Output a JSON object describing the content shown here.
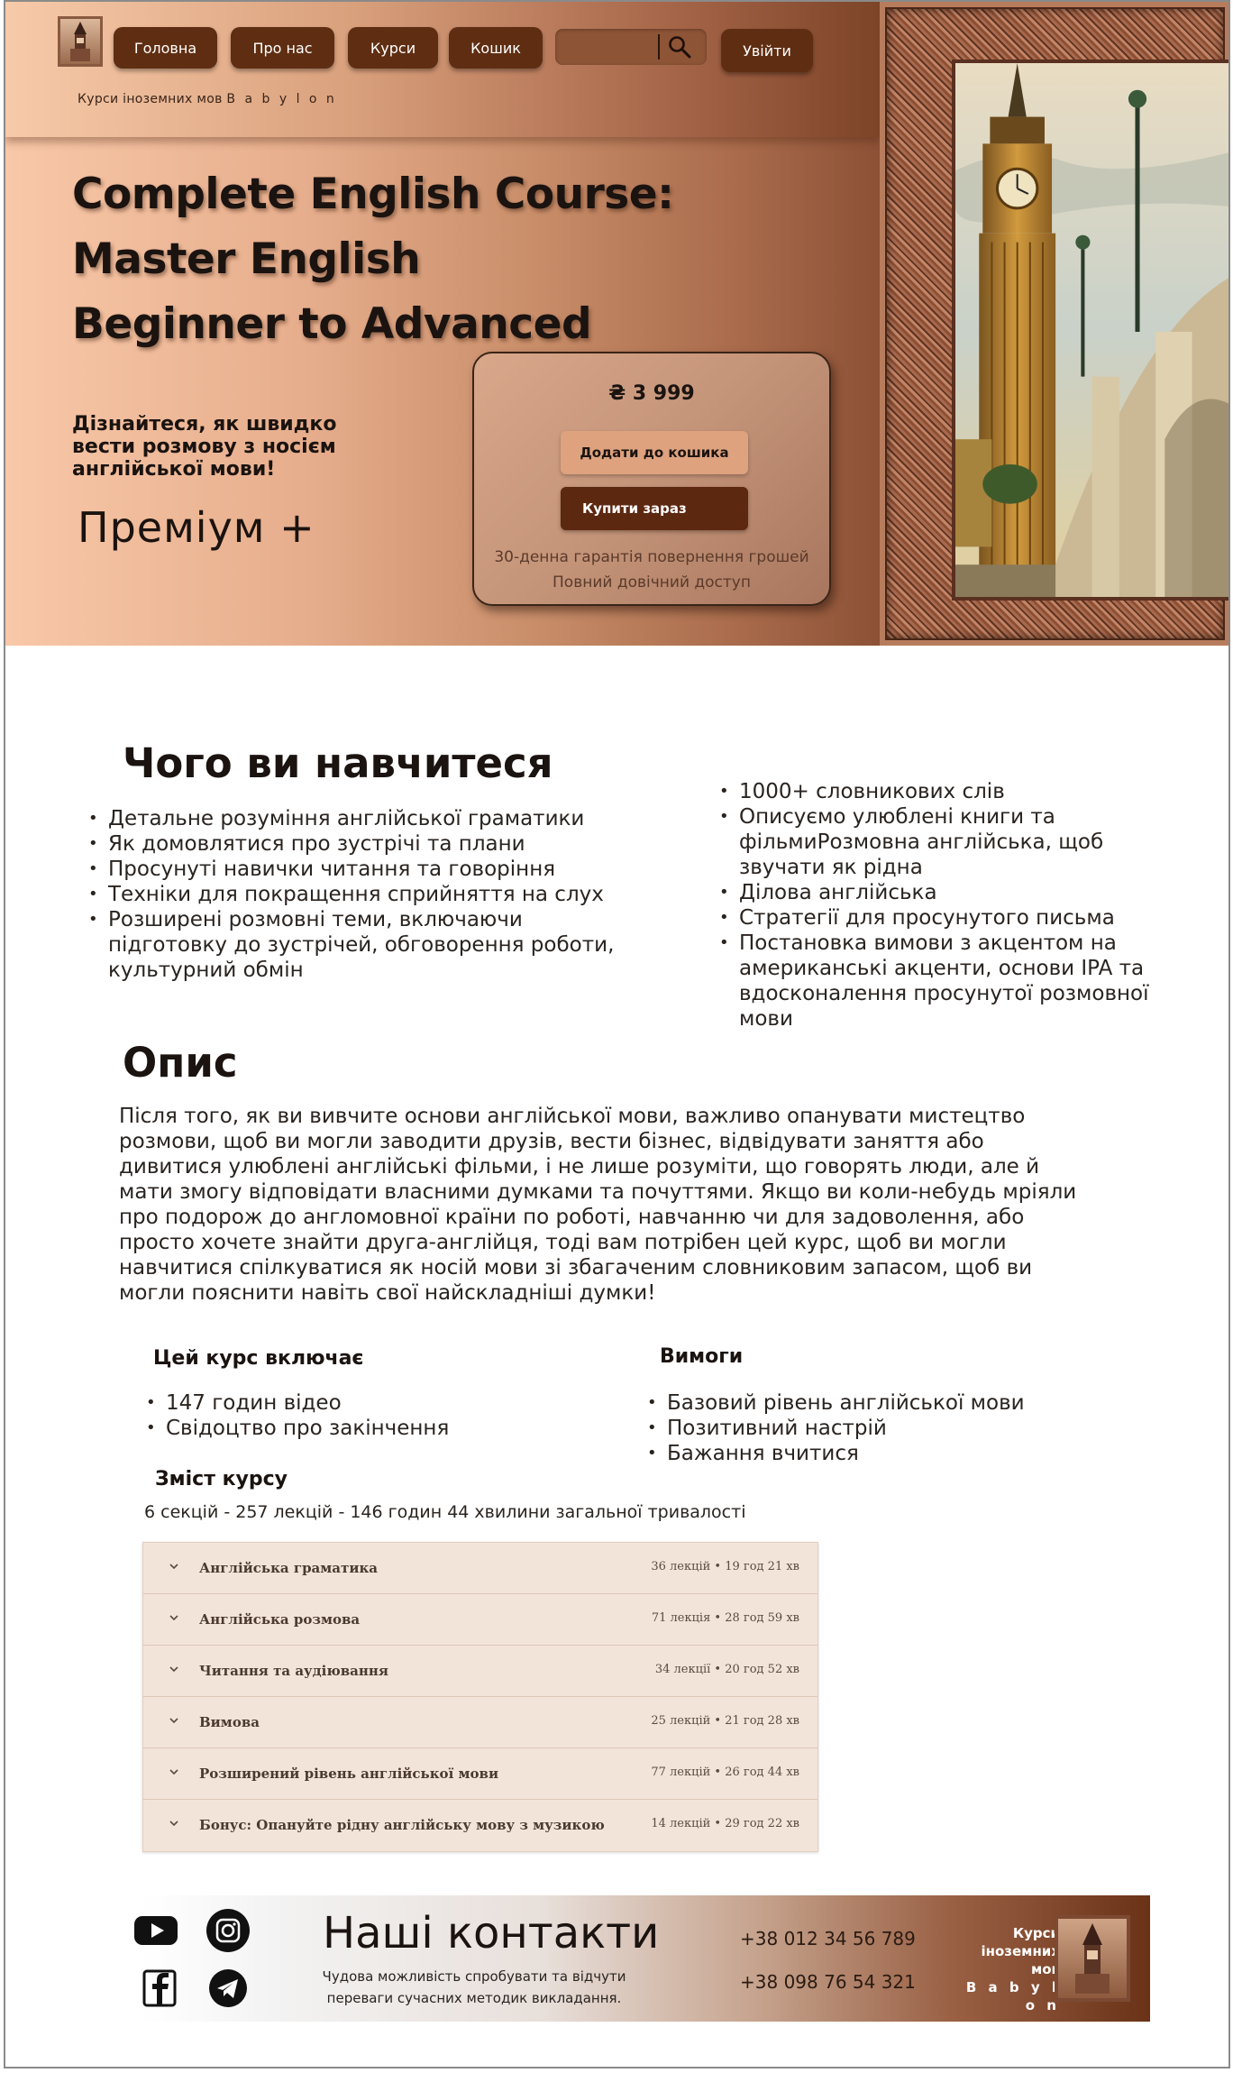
{
  "nav": {
    "home": "Головна",
    "about": "Про нас",
    "courses": "Курси",
    "cart": "Кошик",
    "logout": "Увійти",
    "search_placeholder": ""
  },
  "brand": {
    "tagline": "Курси іноземних мов",
    "name": "B a b y l o n"
  },
  "hero": {
    "title_line1": "Complete English Course:",
    "title_line2": "Master English",
    "title_line3": "Beginner to Advanced",
    "subtitle": "Дізнайтеся, як швидко вести розмову з носієм англійської мови!",
    "tier": "Преміум +"
  },
  "purchase": {
    "price": "₴ 3 999",
    "add_to_cart": "Додати до кошика",
    "buy_now": "Купити зараз",
    "guarantee": "30-денна гарантія повернення грошей",
    "lifetime": "Повний довічний доступ"
  },
  "learn": {
    "heading": "Чого ви навчитеся",
    "left": [
      "Детальне розуміння англійської граматики",
      "Як домовлятися про зустрічі та плани",
      "Просунуті навички читання та говоріння",
      "Техніки для покращення сприйняття на слух",
      "Розширені розмовні теми, включаючи підготовку до зустрічей, обговорення роботи, культурний обмін"
    ],
    "right": [
      "1000+ словникових слів",
      "Описуємо улюблені книги та фільмиРозмовна англійська, щоб звучати як рідна",
      "Ділова англійська",
      "Стратегії для просунутого письма",
      "Постановка вимови з акцентом на американські акценти, основи IPA та вдосконалення просунутої розмовної мови"
    ]
  },
  "description": {
    "heading": "Опис",
    "text": "Після того, як ви вивчите основи англійської мови, важливо опанувати мистецтво розмови, щоб ви могли заводити друзів, вести бізнес, відвідувати заняття або дивитися улюблені англійські фільми, і не лише розуміти, що говорять люди, але й мати змогу відповідати власними думками та почуттями. Якщо ви коли-небудь мріяли про подорож до англомовної країни по роботі, навчанню чи для задоволення, або просто хочете знайти друга-англійця, тоді вам потрібен цей курс, щоб ви могли навчитися спілкуватися як носій мови зі збагаченим словниковим запасом, щоб ви могли пояснити навіть свої найскладніші думки!"
  },
  "includes": {
    "heading": "Цей курс включає",
    "items": [
      "147 годин відео",
      "Свідоцтво про закінчення"
    ]
  },
  "requirements": {
    "heading": "Вимоги",
    "items": [
      "Базовий рівень англійської мови",
      "Позитивний настрій",
      "Бажання вчитися"
    ]
  },
  "content": {
    "heading": "Зміст курсу",
    "summary": "6 секцій - 257 лекцій - 146 годин 44 хвилини загальної тривалості",
    "sections": [
      {
        "title": "Англійська граматика",
        "meta": "36 лекцій • 19 год 21 хв"
      },
      {
        "title": "Англійська розмова",
        "meta": "71 лекція • 28 год 59 хв"
      },
      {
        "title": "Читання та аудіювання",
        "meta": "34 лекції • 20 год 52 хв"
      },
      {
        "title": "Вимова",
        "meta": "25 лекцій • 21 год 28 хв"
      },
      {
        "title": "Розширений рівень англійської мови",
        "meta": "77 лекцій • 26 год 44 хв"
      },
      {
        "title": "Бонус: Опануйте рідну англійську мову з музикою",
        "meta": "14 лекцій • 29 год 22 хв"
      }
    ]
  },
  "footer": {
    "heading": "Наші контакти",
    "subtext": "Чудова можливість спробувати  та відчути переваги сучасних методик викладання.",
    "phone1": "+38 012 34 56 789",
    "phone2": "+38 098 76 54 321",
    "brand_line1": "Курси",
    "brand_line2": "іноземних",
    "brand_line3": "мов",
    "brand_line4": "B a b y l o n",
    "social": [
      "youtube-icon",
      "instagram-icon",
      "facebook-icon",
      "telegram-icon"
    ]
  },
  "colors": {
    "nav_button": "#5f2e12",
    "accent_peach": "#dea27e",
    "accordion_bg": "#f3e4da"
  }
}
